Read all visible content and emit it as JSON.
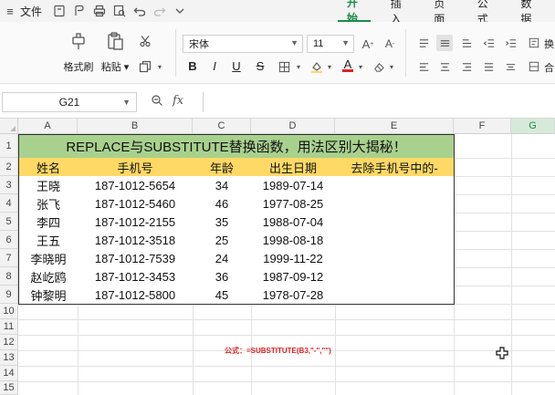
{
  "menubar": {
    "file_label": "文件"
  },
  "tabs": [
    {
      "label": "开始",
      "active": true
    },
    {
      "label": "插入",
      "active": false
    },
    {
      "label": "页面",
      "active": false
    },
    {
      "label": "公式",
      "active": false
    },
    {
      "label": "数据",
      "active": false
    }
  ],
  "ribbon": {
    "format_painter_label": "格式刷",
    "paste_label": "粘贴",
    "font_name": "宋体",
    "font_size": "11",
    "bold": "B",
    "italic": "I",
    "underline": "U",
    "strike": "S",
    "wrap_label": "换",
    "merge_label": "合"
  },
  "formula_bar": {
    "cell_ref": "G21",
    "fx_label": "fx",
    "content": ""
  },
  "columns": [
    "A",
    "B",
    "C",
    "D",
    "E",
    "F",
    "G"
  ],
  "rows": [
    "1",
    "2",
    "3",
    "4",
    "5",
    "6",
    "7",
    "8",
    "9",
    "10",
    "11",
    "12",
    "13",
    "14",
    "15"
  ],
  "sheet": {
    "title": "REPLACE与SUBSTITUTE替换函数，用法区别大揭秘！",
    "headers": [
      "姓名",
      "手机号",
      "年龄",
      "出生日期",
      "去除手机号中的-"
    ],
    "data": [
      [
        "王晓",
        "187-1012-5654",
        "34",
        "1989-07-14",
        ""
      ],
      [
        "张飞",
        "187-1012-5460",
        "46",
        "1977-08-25",
        ""
      ],
      [
        "李四",
        "187-1012-2155",
        "35",
        "1988-07-04",
        ""
      ],
      [
        "王五",
        "187-1012-3518",
        "25",
        "1998-08-18",
        ""
      ],
      [
        "李晓明",
        "187-1012-7539",
        "24",
        "1999-11-22",
        ""
      ],
      [
        "赵屹鸥",
        "187-1012-3453",
        "36",
        "1987-09-12",
        ""
      ],
      [
        "钟黎明",
        "187-1012-5800",
        "45",
        "1978-07-28",
        ""
      ]
    ],
    "formula_note": "公式：=SUBSTITUTE(B3,\"-\",\"\")"
  },
  "colors": {
    "accent": "#1a8c4a",
    "title_fill": "#a9d18e",
    "header_fill": "#ffd966",
    "note": "#e02020"
  }
}
